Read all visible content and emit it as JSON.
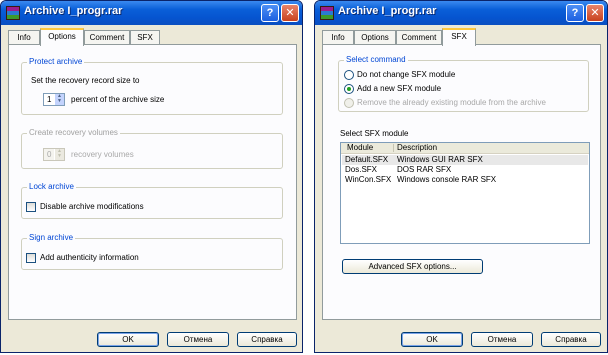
{
  "left_window": {
    "title": "Archive I_progr.rar",
    "tabs": [
      "Info",
      "Options",
      "Comment",
      "SFX"
    ],
    "active_tab": "Options",
    "protect": {
      "title": "Protect archive",
      "caption": "Set the recovery record size to",
      "value": "1",
      "suffix": "percent of the archive size"
    },
    "volumes": {
      "title": "Create recovery volumes",
      "value": "0",
      "suffix": "recovery volumes"
    },
    "lock": {
      "title": "Lock archive",
      "checkbox": "Disable archive modifications"
    },
    "sign": {
      "title": "Sign archive",
      "checkbox": "Add authenticity information"
    },
    "buttons": {
      "ok": "OK",
      "cancel": "Отмена",
      "help": "Справка"
    }
  },
  "right_window": {
    "title": "Archive I_progr.rar",
    "tabs": [
      "Info",
      "Options",
      "Comment",
      "SFX"
    ],
    "active_tab": "SFX",
    "select_command": {
      "title": "Select command",
      "options": [
        {
          "label": "Do not change SFX module",
          "checked": false,
          "enabled": true
        },
        {
          "label": "Add a new SFX module",
          "checked": true,
          "enabled": true
        },
        {
          "label": "Remove the already existing module from the archive",
          "checked": false,
          "enabled": false
        }
      ]
    },
    "select_module": {
      "title": "Select SFX module",
      "columns": [
        "Module",
        "Description"
      ],
      "rows": [
        {
          "module": "Default.SFX",
          "description": "Windows GUI RAR SFX",
          "selected": true
        },
        {
          "module": "Dos.SFX",
          "description": "DOS RAR SFX",
          "selected": false
        },
        {
          "module": "WinCon.SFX",
          "description": "Windows console RAR SFX",
          "selected": false
        }
      ]
    },
    "advanced_button": "Advanced SFX options...",
    "buttons": {
      "ok": "OK",
      "cancel": "Отмена",
      "help": "Справка"
    }
  },
  "title_buttons": {
    "help": "?",
    "close": "✕"
  },
  "colors": {
    "titlebar": "#0654d0",
    "group_title": "#0046d5",
    "active_tab_accent": "#ffc83c",
    "radio_dot": "#21a121",
    "dialog_bg": "#ece9d8"
  }
}
